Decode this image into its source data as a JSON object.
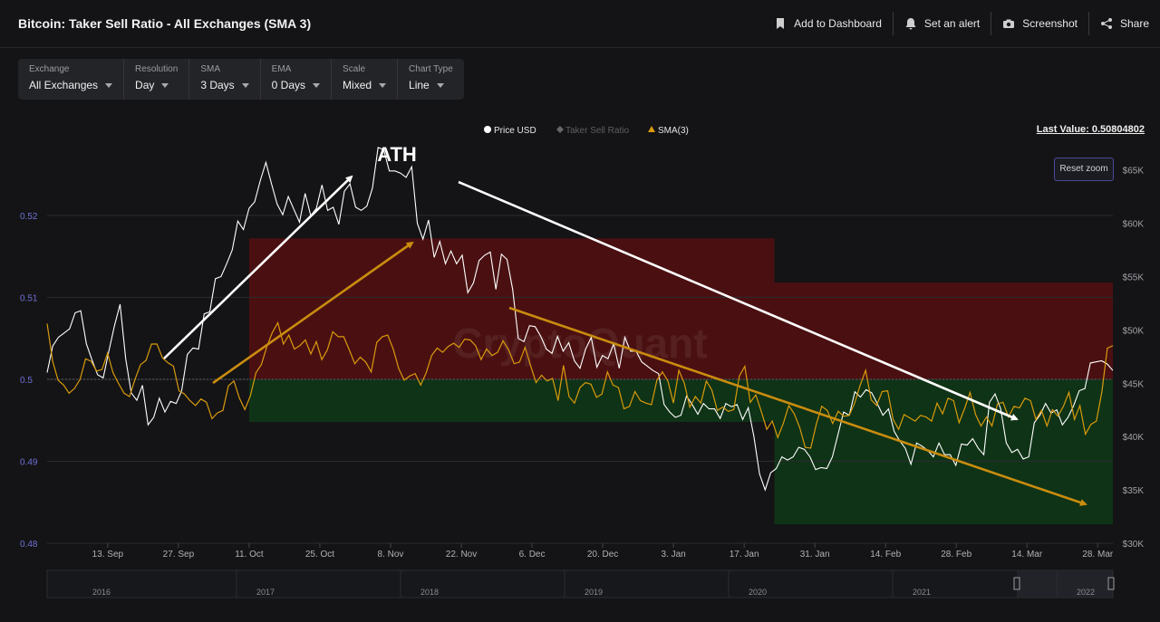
{
  "header": {
    "title": "Bitcoin: Taker Sell Ratio - All Exchanges (SMA 3)",
    "actions": [
      {
        "label": "Add to Dashboard",
        "icon": "bookmark-icon"
      },
      {
        "label": "Set an alert",
        "icon": "bell-icon"
      },
      {
        "label": "Screenshot",
        "icon": "camera-icon"
      },
      {
        "label": "Share",
        "icon": "share-icon"
      }
    ]
  },
  "controls": [
    {
      "label": "Exchange",
      "value": "All Exchanges"
    },
    {
      "label": "Resolution",
      "value": "Day"
    },
    {
      "label": "SMA",
      "value": "3 Days"
    },
    {
      "label": "EMA",
      "value": "0 Days"
    },
    {
      "label": "Scale",
      "value": "Mixed"
    },
    {
      "label": "Chart Type",
      "value": "Line"
    }
  ],
  "legend": {
    "price": "Price USD",
    "ratio": "Taker Sell Ratio",
    "sma": "SMA(3)"
  },
  "last_value": "Last Value: 0.50804802",
  "reset_zoom": "Reset zoom",
  "watermark": "CryptoQuant",
  "annotation": "ATH",
  "colors": {
    "background": "#141416",
    "price": "#ffffff",
    "sma": "#d99a0c",
    "red_zone": "#4a1011",
    "green_zone": "#0f3316",
    "white_arrow": "#ffffff",
    "gold_arrow": "#c98c0f"
  },
  "chart_data": {
    "type": "line",
    "x_ticks": [
      "13. Sep",
      "27. Sep",
      "11. Oct",
      "25. Oct",
      "8. Nov",
      "22. Nov",
      "6. Dec",
      "20. Dec",
      "3. Jan",
      "17. Jan",
      "31. Jan",
      "14. Feb",
      "28. Feb",
      "14. Mar",
      "28. Mar"
    ],
    "left_axis": {
      "ticks": [
        "0.52",
        "0.51",
        "0.5",
        "0.49",
        "0.48"
      ],
      "ylim": [
        0.48,
        0.5275
      ]
    },
    "right_axis": {
      "ticks": [
        "$65K",
        "$60K",
        "$55K",
        "$50K",
        "$45K",
        "$40K",
        "$35K",
        "$30K"
      ],
      "ylim": [
        30000,
        66500
      ]
    },
    "navigator_years": [
      "2016",
      "2017",
      "2018",
      "2019",
      "2020",
      "2021",
      "2022"
    ],
    "series": [
      {
        "name": "Price USD",
        "axis": "right",
        "values": [
          46000,
          48500,
          49300,
          49700,
          50100,
          51600,
          51800,
          48700,
          47200,
          45800,
          45500,
          48000,
          50400,
          52400,
          47300,
          44100,
          43400,
          44800,
          41100,
          41800,
          43600,
          42300,
          43300,
          43100,
          44300,
          47700,
          48300,
          48200,
          51500,
          51700,
          54800,
          55000,
          56200,
          57500,
          60200,
          59400,
          61400,
          62000,
          64000,
          65700,
          63700,
          61800,
          60800,
          62500,
          61300,
          60100,
          62800,
          60700,
          61400,
          63600,
          61200,
          61500,
          59900,
          63000,
          63700,
          61500,
          61200,
          61600,
          63300,
          67100,
          66900,
          64900,
          64900,
          64700,
          64300,
          65300,
          60000,
          58500,
          60300,
          56800,
          58300,
          56200,
          57400,
          56200,
          57000,
          53500,
          54400,
          56500,
          57000,
          57300,
          53800,
          57100,
          56600,
          53800,
          49200,
          48900,
          50400,
          50300,
          49400,
          48200,
          47800,
          49400,
          48000,
          48800,
          47100,
          46400,
          48200,
          49300,
          46500,
          47600,
          47300,
          48700,
          46400,
          49300,
          48000,
          48000,
          47000,
          46600,
          46200,
          45900,
          43000,
          42300,
          41800,
          42000,
          43800,
          43000,
          42100,
          43100,
          42600,
          42600,
          41700,
          43100,
          42800,
          43000,
          41600,
          42700,
          40000,
          36500,
          35000,
          36600,
          37000,
          38100,
          37800,
          38100,
          39000,
          38800,
          38100,
          36900,
          37100,
          37000,
          38100,
          40200,
          42300,
          42000,
          44200,
          43700,
          44400,
          44100,
          43100,
          42000,
          42600,
          40500,
          39600,
          38900,
          37400,
          39400,
          39100,
          38700,
          38100,
          39400,
          38300,
          38300,
          37300,
          39300,
          39200,
          39800,
          38900,
          38300,
          43200,
          44000,
          42600,
          39400,
          38500,
          38800,
          37900,
          38100,
          41300,
          42000,
          43100,
          42200,
          42500,
          41100,
          41800,
          42900,
          44300,
          44500,
          46900,
          47000,
          47100,
          46800,
          46200
        ],
        "x_range": [
          "2021-09-01",
          "2022-03-31"
        ]
      },
      {
        "name": "SMA(3)",
        "axis": "left",
        "values": [
          0.5068,
          0.5022,
          0.4999,
          0.4993,
          0.4983,
          0.4989,
          0.5,
          0.5025,
          0.5022,
          0.501,
          0.5012,
          0.5032,
          0.5008,
          0.4995,
          0.4983,
          0.4979,
          0.5,
          0.5018,
          0.5023,
          0.5043,
          0.5043,
          0.5026,
          0.502,
          0.5016,
          0.4986,
          0.4982,
          0.4974,
          0.4968,
          0.4976,
          0.4972,
          0.4952,
          0.4959,
          0.4962,
          0.4992,
          0.4998,
          0.4977,
          0.4963,
          0.498,
          0.5008,
          0.5018,
          0.504,
          0.5057,
          0.5069,
          0.5043,
          0.5054,
          0.5037,
          0.5041,
          0.5048,
          0.5031,
          0.5046,
          0.5024,
          0.5036,
          0.5058,
          0.5052,
          0.5052,
          0.5036,
          0.5019,
          0.5027,
          0.5021,
          0.5009,
          0.5045,
          0.5052,
          0.5054,
          0.5037,
          0.5013,
          0.4999,
          0.5004,
          0.5007,
          0.4993,
          0.5008,
          0.5029,
          0.5038,
          0.5033,
          0.504,
          0.5044,
          0.5039,
          0.5049,
          0.5048,
          0.5041,
          0.5024,
          0.5037,
          0.5029,
          0.5033,
          0.5047,
          0.5036,
          0.5019,
          0.5021,
          0.5039,
          0.5017,
          0.4996,
          0.5005,
          0.4998,
          0.5001,
          0.4974,
          0.5017,
          0.4979,
          0.4971,
          0.499,
          0.4996,
          0.4994,
          0.4978,
          0.4982,
          0.5009,
          0.4993,
          0.499,
          0.4964,
          0.4967,
          0.4985,
          0.4974,
          0.4971,
          0.4969,
          0.4999,
          0.5009,
          0.4998,
          0.4971,
          0.5011,
          0.4995,
          0.4966,
          0.4979,
          0.4971,
          0.4998,
          0.4987,
          0.4962,
          0.4966,
          0.4961,
          0.4963,
          0.5004,
          0.5016,
          0.4972,
          0.4981,
          0.4961,
          0.4939,
          0.4949,
          0.4929,
          0.4946,
          0.4968,
          0.4958,
          0.4941,
          0.4917,
          0.4916,
          0.4945,
          0.4967,
          0.4962,
          0.4946,
          0.4961,
          0.4955,
          0.4956,
          0.4971,
          0.4993,
          0.5011,
          0.4975,
          0.4968,
          0.4985,
          0.4986,
          0.4951,
          0.4939,
          0.4957,
          0.4953,
          0.4949,
          0.4956,
          0.4954,
          0.4949,
          0.4971,
          0.4958,
          0.4977,
          0.4974,
          0.4947,
          0.4964,
          0.4984,
          0.4957,
          0.4943,
          0.4954,
          0.4943,
          0.497,
          0.4972,
          0.4954,
          0.4967,
          0.4965,
          0.4977,
          0.4974,
          0.4951,
          0.4962,
          0.4943,
          0.4963,
          0.4955,
          0.4967,
          0.4984,
          0.4951,
          0.4968,
          0.4933,
          0.4945,
          0.4949,
          0.4985,
          0.5038,
          0.5041
        ],
        "x_range": [
          "2021-09-01",
          "2022-03-31"
        ]
      }
    ],
    "zones": [
      {
        "kind": "red",
        "from": "2021-10-11",
        "to": "2022-01-23",
        "y": [
          0.5,
          0.5172
        ]
      },
      {
        "kind": "green",
        "from": "2021-10-11",
        "to": "2022-01-23",
        "y": [
          0.4948,
          0.5
        ]
      },
      {
        "kind": "red",
        "from": "2022-01-23",
        "to": "2022-03-31",
        "y": [
          0.5,
          0.5118
        ]
      },
      {
        "kind": "green",
        "from": "2022-01-23",
        "to": "2022-03-31",
        "y": [
          0.4823,
          0.5
        ]
      }
    ],
    "baseline": 0.5,
    "grid": true
  }
}
